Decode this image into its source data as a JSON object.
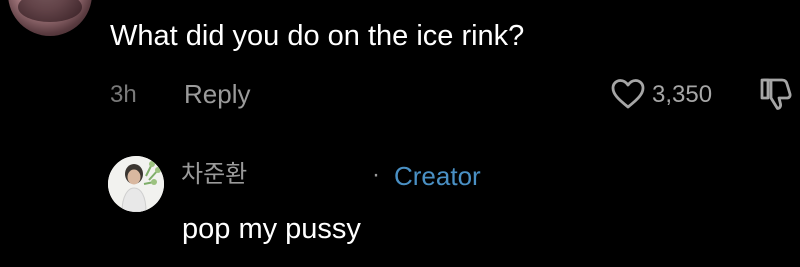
{
  "comment": {
    "text": "What did you do on the ice rink?",
    "time": "3h",
    "reply_label": "Reply",
    "likes": "3,350"
  },
  "reply": {
    "author": "차준환",
    "separator": "·",
    "badge": "Creator",
    "text": "pop my pussy"
  },
  "icons": {
    "like": "heart-outline-icon",
    "dislike": "thumbs-down-outline-icon"
  },
  "colors": {
    "background": "#000000",
    "text": "#ffffff",
    "secondary": "#9a9a9a",
    "creator_accent": "#4a90c4"
  }
}
